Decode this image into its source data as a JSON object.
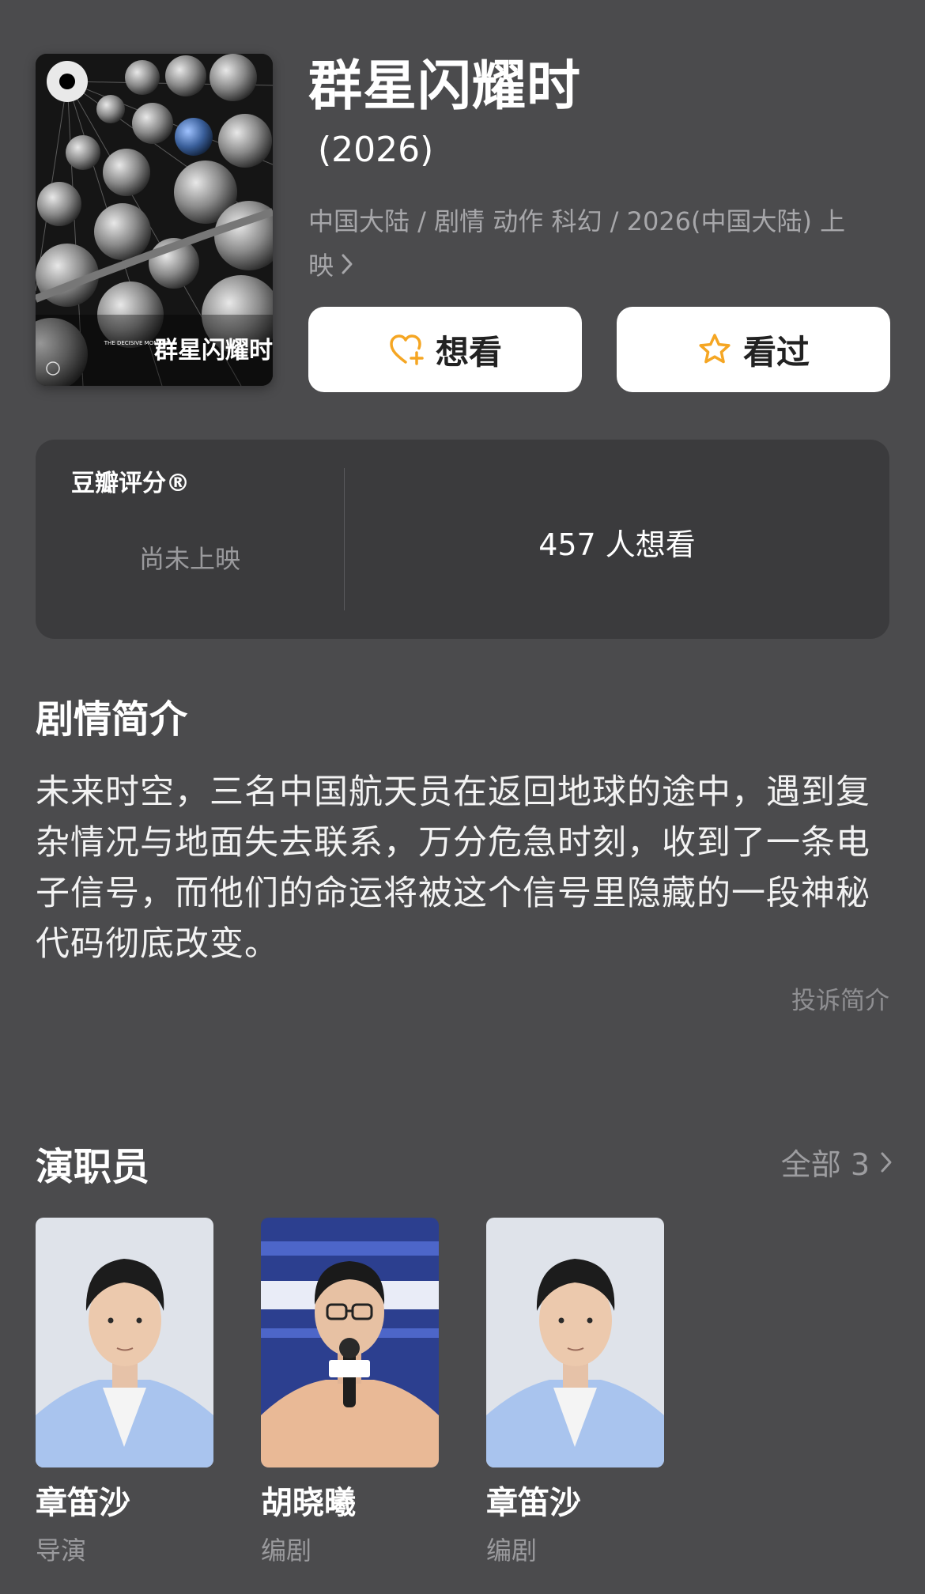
{
  "movie": {
    "title": "群星闪耀时",
    "year": "(2026)",
    "meta": "中国大陆 / 剧情 动作 科幻 / 2026(中国大陆) 上映"
  },
  "poster": {
    "title_text": "群星闪耀时",
    "english_text": "THE DECISIVE MOMENT"
  },
  "actions": {
    "want_label": "想看",
    "seen_label": "看过"
  },
  "rating": {
    "brand": "豆瓣评分®",
    "status": "尚未上映",
    "wish_count": "457 人想看"
  },
  "synopsis": {
    "heading": "剧情简介",
    "text": "未来时空，三名中国航天员在返回地球的途中，遇到复杂情况与地面失去联系，万分危急时刻，收到了一条电子信号，而他们的命运将被这个信号里隐藏的一段神秘代码彻底改变。",
    "report_label": "投诉简介"
  },
  "cast": {
    "heading": "演职员",
    "all_label": "全部 3",
    "members": [
      {
        "name": "章笛沙",
        "role": "导演"
      },
      {
        "name": "胡晓曦",
        "role": "编剧"
      },
      {
        "name": "章笛沙",
        "role": "编剧"
      }
    ]
  },
  "colors": {
    "background": "#4b4b4d",
    "card": "#3b3b3d",
    "accent": "#f5a623"
  },
  "icons": {
    "want": "heart-plus-icon",
    "seen": "star-outline-icon",
    "more": "chevron-right-icon"
  }
}
